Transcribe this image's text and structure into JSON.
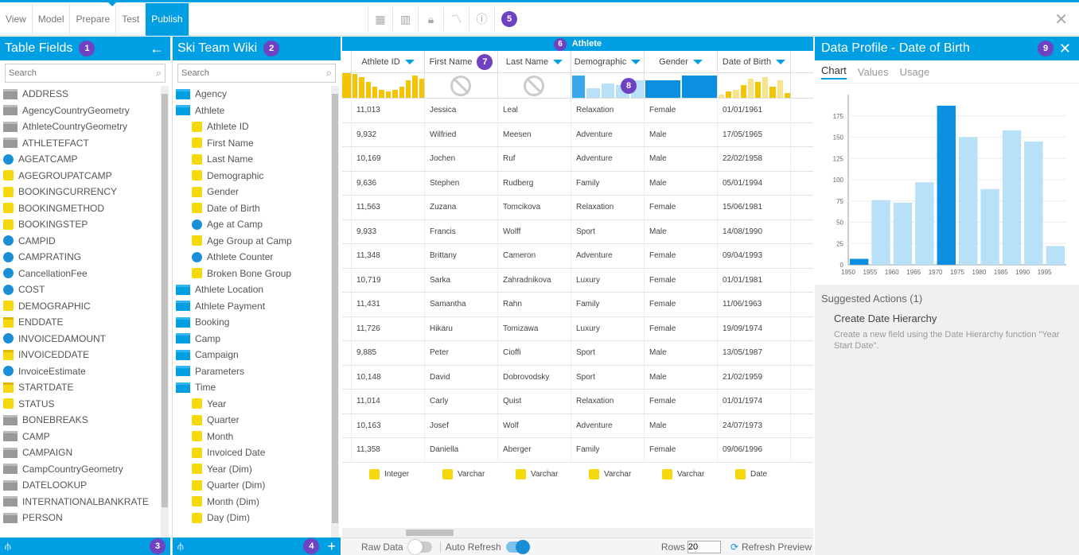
{
  "nav": {
    "tabs": [
      "View",
      "Model",
      "Prepare",
      "Test",
      "Publish"
    ],
    "active": "Publish",
    "badge": "5"
  },
  "tables": {
    "title": "Table Fields",
    "badge": "1",
    "search": "Search",
    "footer_badge": "3",
    "items": [
      {
        "t": "f",
        "l": "ADDRESS"
      },
      {
        "t": "f",
        "l": "AgencyCountryGeometry"
      },
      {
        "t": "f",
        "l": "AthleteCountryGeometry"
      },
      {
        "t": "f",
        "l": "ATHLETEFACT"
      },
      {
        "t": "d",
        "l": "AGEATCAMP"
      },
      {
        "t": "s",
        "l": "AGEGROUPATCAMP"
      },
      {
        "t": "s",
        "l": "BOOKINGCURRENCY"
      },
      {
        "t": "s",
        "l": "BOOKINGMETHOD"
      },
      {
        "t": "s",
        "l": "BOOKINGSTEP"
      },
      {
        "t": "d",
        "l": "CAMPID"
      },
      {
        "t": "d",
        "l": "CAMPRATING"
      },
      {
        "t": "d",
        "l": "CancellationFee"
      },
      {
        "t": "d",
        "l": "COST"
      },
      {
        "t": "s",
        "l": "DEMOGRAPHIC"
      },
      {
        "t": "c",
        "l": "ENDDATE"
      },
      {
        "t": "d",
        "l": "INVOICEDAMOUNT"
      },
      {
        "t": "c",
        "l": "INVOICEDDATE"
      },
      {
        "t": "d",
        "l": "InvoiceEstimate"
      },
      {
        "t": "c",
        "l": "STARTDATE"
      },
      {
        "t": "s",
        "l": "STATUS"
      },
      {
        "t": "f",
        "l": "BONEBREAKS"
      },
      {
        "t": "f",
        "l": "CAMP"
      },
      {
        "t": "f",
        "l": "CAMPAIGN"
      },
      {
        "t": "f",
        "l": "CampCountryGeometry"
      },
      {
        "t": "f",
        "l": "DATELOOKUP"
      },
      {
        "t": "f",
        "l": "INTERNATIONALBANKRATE"
      },
      {
        "t": "f",
        "l": "PERSON"
      }
    ]
  },
  "wiki": {
    "title": "Ski Team Wiki",
    "badge": "2",
    "search": "Search",
    "footer_badge": "4",
    "items": [
      {
        "t": "b",
        "l": "Agency",
        "i": 0
      },
      {
        "t": "b",
        "l": "Athlete",
        "i": 0
      },
      {
        "t": "s",
        "l": "Athlete ID",
        "i": 1
      },
      {
        "t": "s",
        "l": "First Name",
        "i": 1
      },
      {
        "t": "s",
        "l": "Last Name",
        "i": 1
      },
      {
        "t": "s",
        "l": "Demographic",
        "i": 1
      },
      {
        "t": "s",
        "l": "Gender",
        "i": 1
      },
      {
        "t": "s",
        "l": "Date of Birth",
        "i": 1
      },
      {
        "t": "d",
        "l": "Age at Camp",
        "i": 1
      },
      {
        "t": "s",
        "l": "Age Group at Camp",
        "i": 1
      },
      {
        "t": "d",
        "l": "Athlete Counter",
        "i": 1
      },
      {
        "t": "s",
        "l": "Broken Bone Group",
        "i": 1
      },
      {
        "t": "b",
        "l": "Athlete Location",
        "i": 0
      },
      {
        "t": "b",
        "l": "Athlete Payment",
        "i": 0
      },
      {
        "t": "b",
        "l": "Booking",
        "i": 0
      },
      {
        "t": "b",
        "l": "Camp",
        "i": 0
      },
      {
        "t": "b",
        "l": "Campaign",
        "i": 0
      },
      {
        "t": "b",
        "l": "Parameters",
        "i": 0
      },
      {
        "t": "b",
        "l": "Time",
        "i": 0
      },
      {
        "t": "s",
        "l": "Year",
        "i": 1
      },
      {
        "t": "s",
        "l": "Quarter",
        "i": 1
      },
      {
        "t": "s",
        "l": "Month",
        "i": 1
      },
      {
        "t": "s",
        "l": "Invoiced Date",
        "i": 1
      },
      {
        "t": "s",
        "l": "Year (Dim)",
        "i": 1
      },
      {
        "t": "s",
        "l": "Quarter (Dim)",
        "i": 1
      },
      {
        "t": "s",
        "l": "Month (Dim)",
        "i": 1
      },
      {
        "t": "s",
        "l": "Day (Dim)",
        "i": 1
      }
    ]
  },
  "grid": {
    "title": "Athlete",
    "title_badge": "6",
    "first_name_badge": "7",
    "profile_badge": "8",
    "columns": [
      "Athlete ID",
      "First Name",
      "Last Name",
      "Demographic",
      "Gender",
      "Date of Birth"
    ],
    "rows": [
      [
        "11,013",
        "Jessica",
        "Leal",
        "Relaxation",
        "Female",
        "01/01/1961"
      ],
      [
        "9,932",
        "Wilfried",
        "Meesen",
        "Adventure",
        "Male",
        "17/05/1965"
      ],
      [
        "10,169",
        "Jochen",
        "Ruf",
        "Adventure",
        "Male",
        "22/02/1958"
      ],
      [
        "9,636",
        "Stephen",
        "Rudberg",
        "Family",
        "Male",
        "05/01/1994"
      ],
      [
        "11,563",
        "Zuzana",
        "Tomcikova",
        "Relaxation",
        "Female",
        "15/06/1981"
      ],
      [
        "9,933",
        "Francis",
        "Wolff",
        "Sport",
        "Male",
        "14/08/1990"
      ],
      [
        "11,348",
        "Brittany",
        "Cameron",
        "Adventure",
        "Female",
        "09/04/1993"
      ],
      [
        "10,719",
        "Sarka",
        "Zahradnikova",
        "Luxury",
        "Female",
        "01/01/1981"
      ],
      [
        "11,431",
        "Samantha",
        "Rahn",
        "Family",
        "Female",
        "11/06/1963"
      ],
      [
        "11,726",
        "Hikaru",
        "Tomizawa",
        "Luxury",
        "Female",
        "19/09/1974"
      ],
      [
        "9,885",
        "Peter",
        "Cioffi",
        "Sport",
        "Male",
        "13/05/1987"
      ],
      [
        "10,148",
        "David",
        "Dobrovodsky",
        "Sport",
        "Male",
        "21/02/1959"
      ],
      [
        "11,014",
        "Carly",
        "Quist",
        "Relaxation",
        "Female",
        "01/01/1974"
      ],
      [
        "10,163",
        "Josef",
        "Wolf",
        "Adventure",
        "Male",
        "24/07/1973"
      ],
      [
        "11,358",
        "Daniella",
        "Aberger",
        "Family",
        "Female",
        "09/06/1996"
      ]
    ],
    "types": [
      "Integer",
      "Varchar",
      "Varchar",
      "Varchar",
      "Varchar",
      "Date"
    ],
    "raw_data": "Raw Data",
    "auto_refresh": "Auto Refresh",
    "rows_label": "Rows",
    "rows_value": "20",
    "refresh": "Refresh Preview"
  },
  "profile": {
    "title": "Data Profile - Date of Birth",
    "badge": "9",
    "tabs": [
      "Chart",
      "Values",
      "Usage"
    ],
    "suggested": "Suggested Actions (1)",
    "action_title": "Create Date Hierarchy",
    "action_desc": "Create a new field using the Date Hierarchy function \"Year Start Date\"."
  },
  "chart_data": {
    "type": "bar",
    "x": [
      1950,
      1955,
      1960,
      1965,
      1970,
      1975,
      1980,
      1985,
      1990,
      1995
    ],
    "values": [
      7,
      76,
      73,
      97,
      187,
      150,
      89,
      158,
      145,
      22
    ],
    "highlight": [
      1950,
      1970
    ],
    "ylim": [
      0,
      200
    ],
    "yticks": [
      0,
      25,
      50,
      75,
      100,
      125,
      150,
      175
    ],
    "xticks": [
      "1950",
      "1955",
      "1960",
      "1965",
      "1970",
      "1975",
      "1980",
      "1985",
      "1990",
      "1995"
    ],
    "colors": {
      "bar": "#b8e0f7",
      "highlight": "#0b8fe0"
    }
  }
}
